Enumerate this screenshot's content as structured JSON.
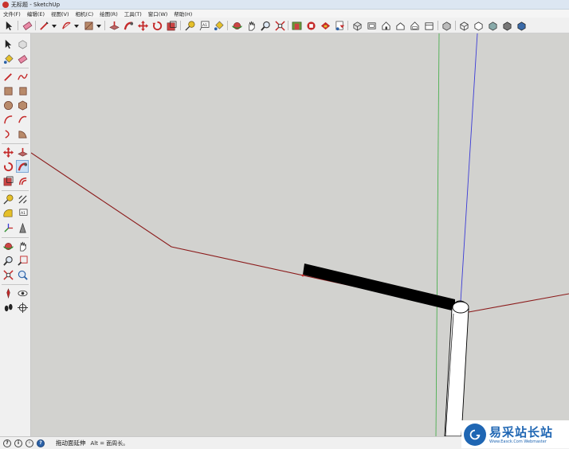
{
  "window": {
    "title": "无标题 - SketchUp"
  },
  "menu": [
    {
      "label": "文件(F)"
    },
    {
      "label": "编辑(E)"
    },
    {
      "label": "视图(V)"
    },
    {
      "label": "相机(C)"
    },
    {
      "label": "绘图(R)"
    },
    {
      "label": "工具(T)"
    },
    {
      "label": "窗口(W)"
    },
    {
      "label": "帮助(H)"
    }
  ],
  "status": {
    "text": "拖动面延伸",
    "hint": "Alt = 面周长。"
  },
  "watermark": {
    "text": "易采站长站",
    "url": "Www.Easck.Com Webmaster"
  },
  "colors": {
    "viewport_bg": "#d2d2cf",
    "red_axis": "#8b1a1a",
    "green_axis": "#4caf50",
    "blue_axis": "#3b3bd6",
    "edge": "#000000"
  }
}
